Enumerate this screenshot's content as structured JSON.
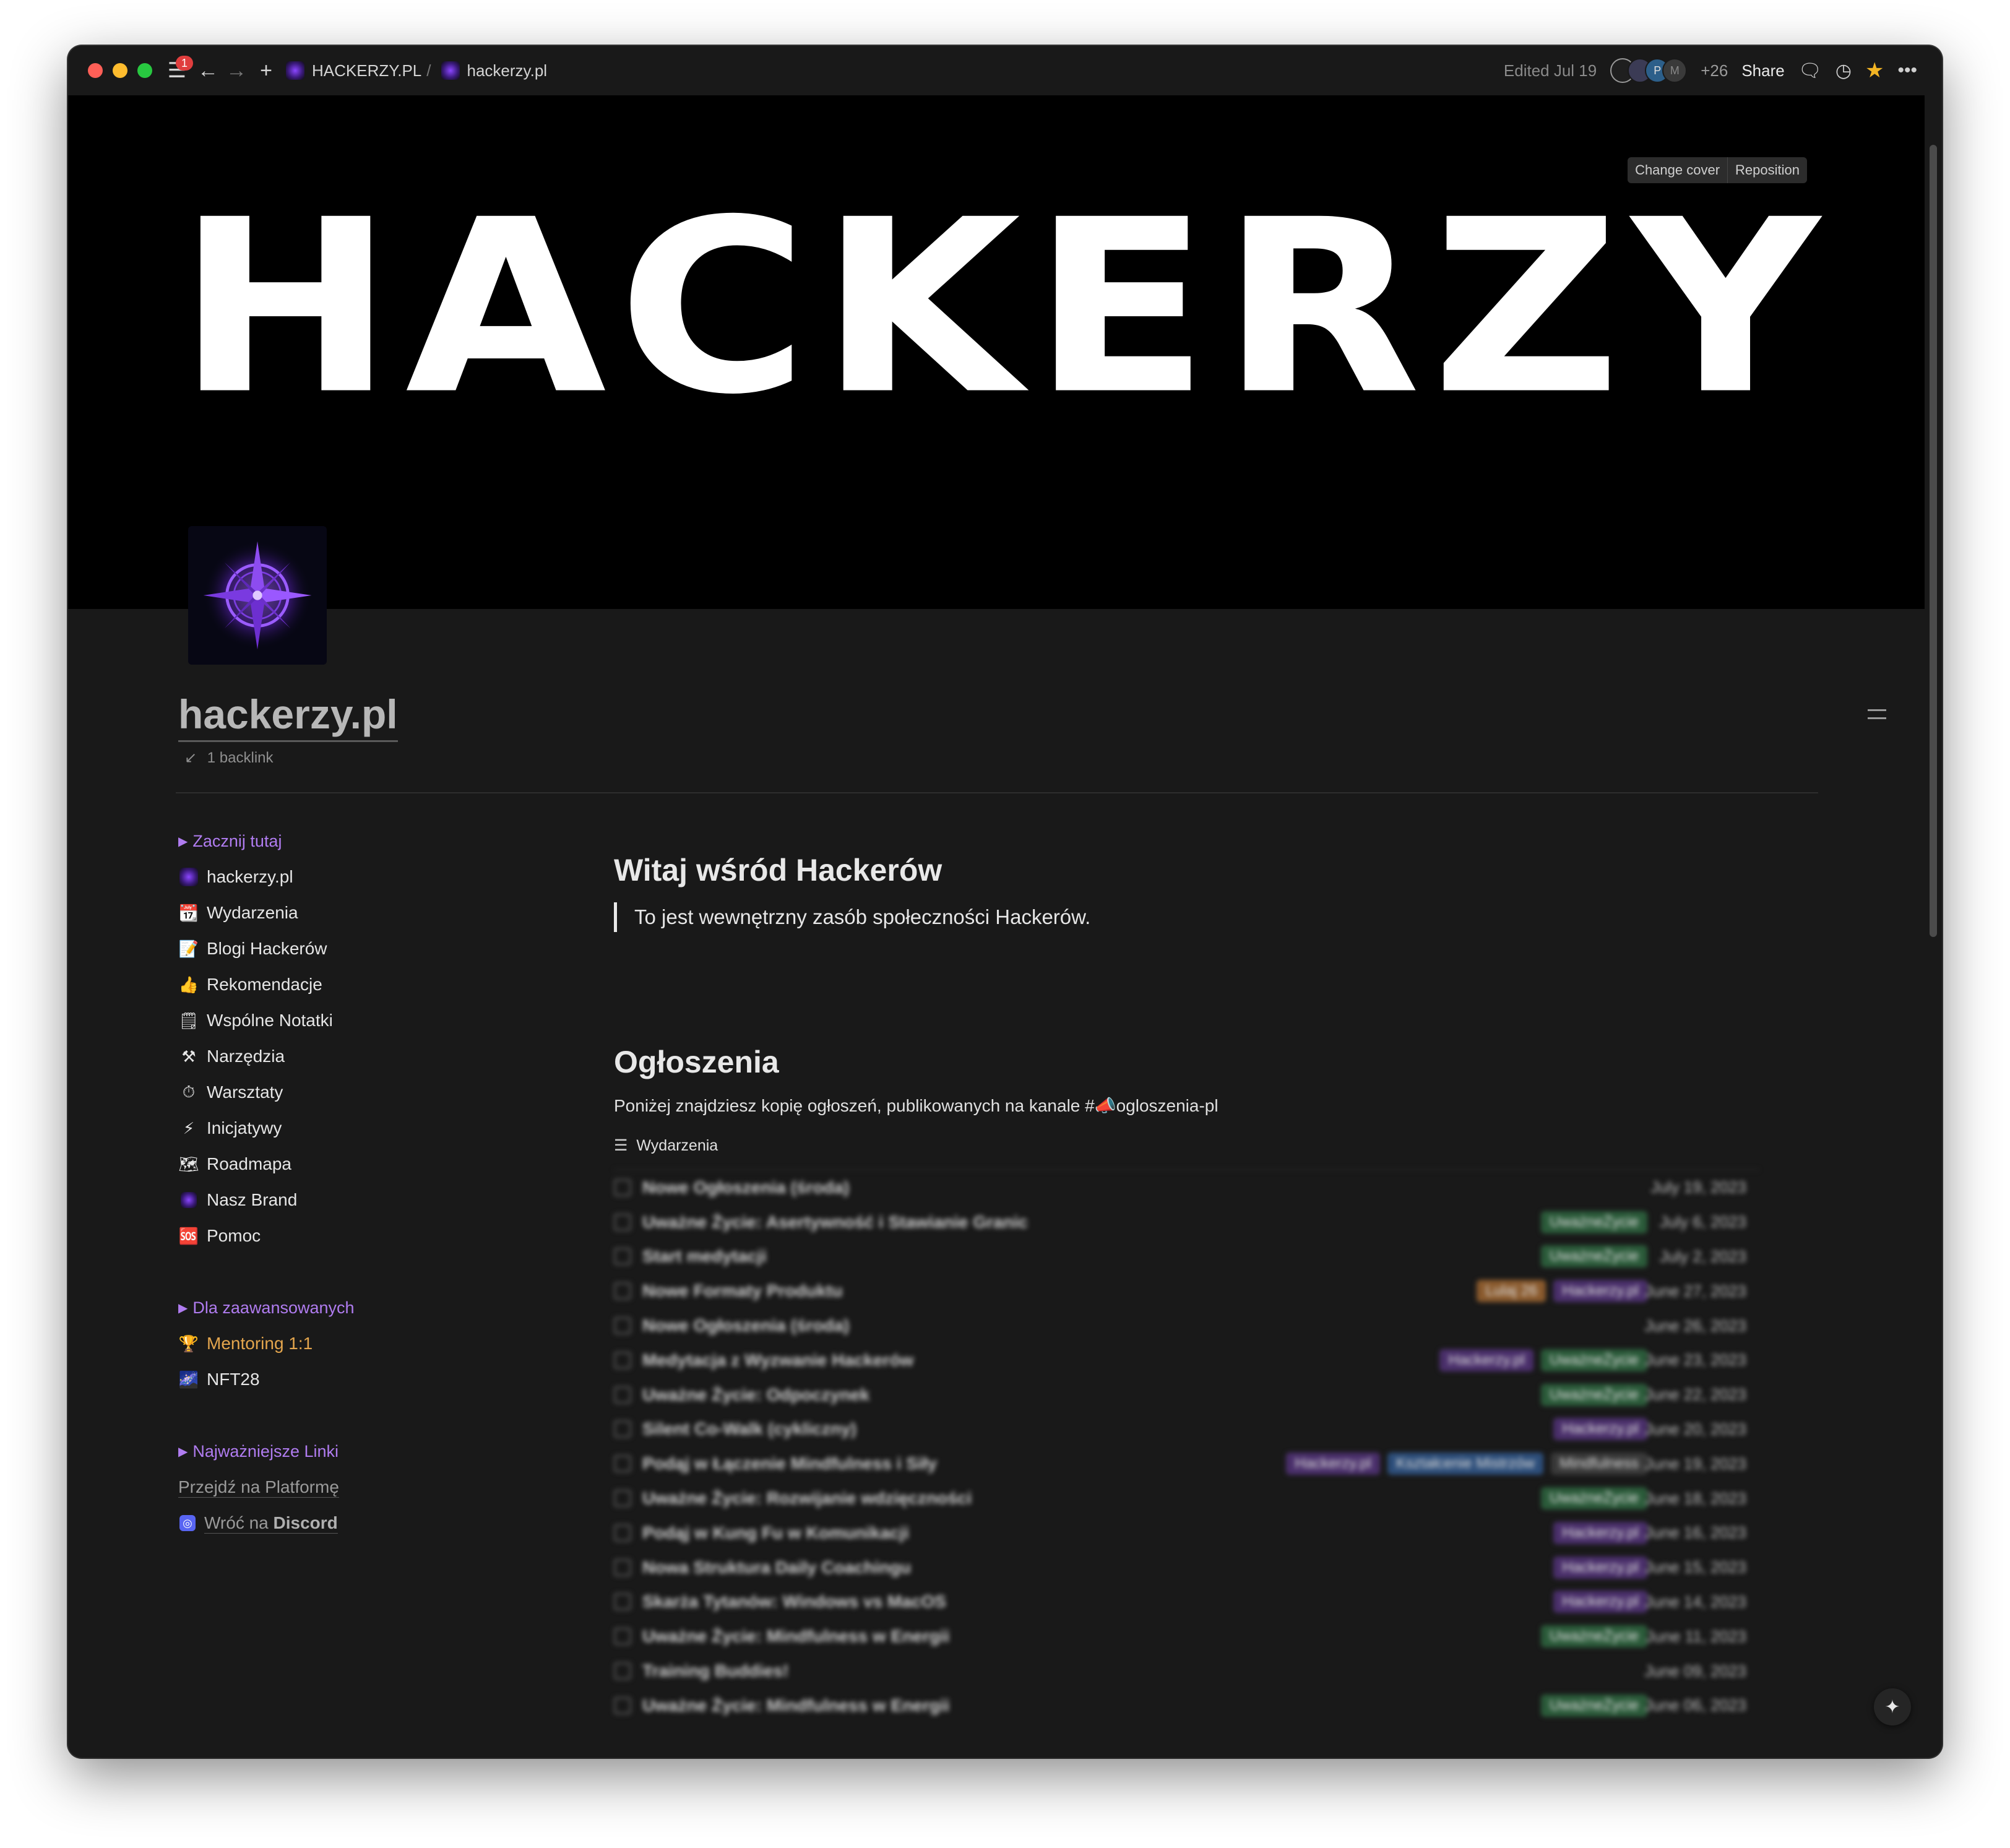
{
  "titlebar": {
    "notification_count": "1",
    "breadcrumb_root": "HACKERZY.PL",
    "breadcrumb_sep": "/",
    "breadcrumb_page": "hackerzy.pl",
    "edited": "Edited Jul 19",
    "avatars": [
      "",
      "",
      "P",
      "M"
    ],
    "more_count": "+26",
    "share": "Share"
  },
  "cover": {
    "text": "HACKERZY",
    "change_cover": "Change cover",
    "reposition": "Reposition"
  },
  "page": {
    "title": "hackerzy.pl",
    "backlink": "1 backlink"
  },
  "sidebar": {
    "section1": "Zacznij tutaj",
    "items": [
      {
        "icon": "logo",
        "label": "hackerzy.pl"
      },
      {
        "icon": "📆",
        "label": "Wydarzenia"
      },
      {
        "icon": "📝",
        "label": "Blogi Hackerów"
      },
      {
        "icon": "👍",
        "label": "Rekomendacje"
      },
      {
        "icon": "🗒",
        "label": "Wspólne Notatki"
      },
      {
        "icon": "⚒",
        "label": "Narzędzia"
      },
      {
        "icon": "⏱",
        "label": "Warsztaty"
      },
      {
        "icon": "⚡",
        "label": "Inicjatywy"
      },
      {
        "icon": "🗺",
        "label": "Roadmapa"
      },
      {
        "icon": "logo",
        "label": "Nasz Brand"
      },
      {
        "icon": "🆘",
        "label": "Pomoc"
      }
    ],
    "section2": "Dla zaawansowanych",
    "advanced": [
      {
        "icon": "🏆",
        "label": "Mentoring 1:1"
      },
      {
        "icon": "🌌",
        "label": "NFT28"
      }
    ],
    "section3": "Najważniejsze Linki",
    "links": {
      "platform": "Przejdź na Platformę",
      "discord_prefix": "Wróć na",
      "discord_strong": "Discord"
    }
  },
  "content": {
    "welcome_heading": "Witaj wśród Hackerów",
    "welcome_quote": "To jest wewnętrzny zasób społeczności Hackerów.",
    "announcements_heading": "Ogłoszenia",
    "announcements_text": "Poniżej znajdziesz kopię ogłoszeń, publikowanych na kanale #📣ogloszenia-pl",
    "database_title": "Wydarzenia"
  },
  "rows": [
    {
      "name": "Nowe Ogłoszenia (środa)",
      "tags": [],
      "date": "July 19, 2023"
    },
    {
      "name": "Uważne Życie: Asertywność i Stawianie Granic",
      "tags": [
        {
          "t": "UważneŻycie",
          "c": "green"
        }
      ],
      "date": "July 6, 2023"
    },
    {
      "name": "Start medytacji",
      "tags": [
        {
          "t": "UważneŻycie",
          "c": "green"
        }
      ],
      "date": "July 2, 2023"
    },
    {
      "name": "Nowe Formaty Produktu",
      "tags": [
        {
          "t": "Lulaj 26",
          "c": "orange"
        },
        {
          "t": "Hackerzy.pl",
          "c": "purple"
        }
      ],
      "date": "June 27, 2023"
    },
    {
      "name": "Nowe Ogłoszenia (środa)",
      "tags": [],
      "date": "June 26, 2023"
    },
    {
      "name": "Medytacja z Wyzwanie Hackerów",
      "tags": [
        {
          "t": "Hackerzy.pl",
          "c": "purple"
        },
        {
          "t": "UważneŻycie",
          "c": "green"
        }
      ],
      "date": "June 23, 2023"
    },
    {
      "name": "Uważne Życie: Odpoczynek",
      "tags": [
        {
          "t": "UważneŻycie",
          "c": "green"
        }
      ],
      "date": "June 22, 2023"
    },
    {
      "name": "Silent Co-Walk (cykliczny)",
      "tags": [
        {
          "t": "Hackerzy.pl",
          "c": "purple"
        }
      ],
      "date": "June 20, 2023"
    },
    {
      "name": "Podąj w Łączenie Mindfulness i Siły",
      "tags": [
        {
          "t": "Hackerzy.pl",
          "c": "purple"
        },
        {
          "t": "Kształcenie Mistrzów",
          "c": "blue"
        },
        {
          "t": "Mindfulness",
          "c": "gray"
        }
      ],
      "date": "June 19, 2023"
    },
    {
      "name": "Uważne Życie: Rozwijanie wdzięczności",
      "tags": [
        {
          "t": "UważneŻycie",
          "c": "green"
        }
      ],
      "date": "June 18, 2023"
    },
    {
      "name": "Podąj w Kung Fu w Komunikacji",
      "tags": [
        {
          "t": "Hackerzy.pl",
          "c": "purple"
        }
      ],
      "date": "June 16, 2023"
    },
    {
      "name": "Nowa Struktura Daily Coachingu",
      "tags": [
        {
          "t": "Hackerzy.pl",
          "c": "purple"
        }
      ],
      "date": "June 15, 2023"
    },
    {
      "name": "Skarża Tytanów: Windows vs MacOS",
      "tags": [
        {
          "t": "Hackerzy.pl",
          "c": "purple"
        }
      ],
      "date": "June 14, 2023"
    },
    {
      "name": "Uważne Życie: Mindfulness w Energii",
      "tags": [
        {
          "t": "UważneŻycie",
          "c": "green"
        }
      ],
      "date": "June 11, 2023"
    },
    {
      "name": "Training Buddies!",
      "tags": [],
      "date": "June 09, 2023"
    },
    {
      "name": "Uważne Życie: Mindfulness w Energii",
      "tags": [
        {
          "t": "UważneŻycie",
          "c": "green"
        }
      ],
      "date": "June 06, 2023"
    }
  ]
}
